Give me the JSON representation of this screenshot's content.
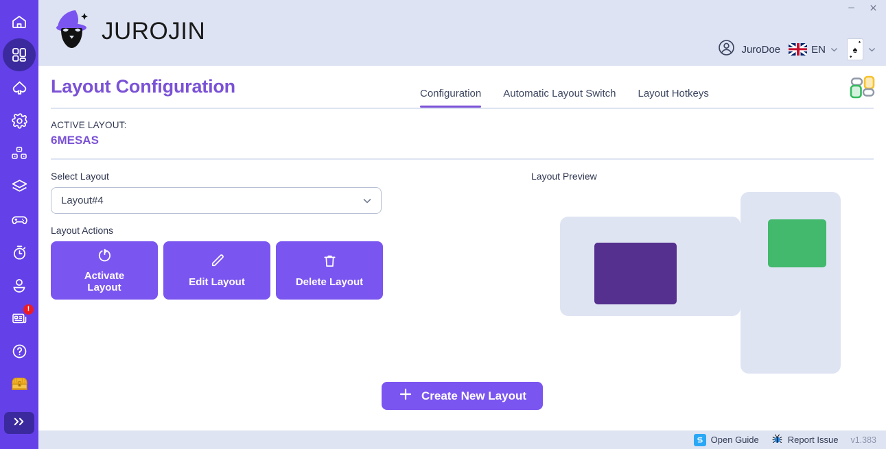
{
  "window": {
    "minimize_label": "—",
    "close_label": "✕"
  },
  "brand": {
    "name": "JUROJIN",
    "logo_icon": "wizard-logo-icon"
  },
  "header": {
    "user_name": "JuroDoe",
    "user_icon": "user-circle-icon",
    "language_code": "EN",
    "language_flag": "uk-flag-icon",
    "card_icon": "ace-of-spades-card-icon",
    "card_suit": "♠",
    "chevron_icon": "chevron-down-icon",
    "layout_grid_icon": "layout-grid-icon"
  },
  "page": {
    "title": "Layout Configuration"
  },
  "tabs": [
    {
      "label": "Configuration",
      "active": true
    },
    {
      "label": "Automatic Layout Switch",
      "active": false
    },
    {
      "label": "Layout Hotkeys",
      "active": false
    }
  ],
  "active_layout": {
    "label": "ACTIVE LAYOUT:",
    "value": "6MESAS"
  },
  "select_layout": {
    "label": "Select Layout",
    "value": "Layout#4",
    "chevron_icon": "chevron-down-icon"
  },
  "layout_actions": {
    "label": "Layout Actions",
    "buttons": [
      {
        "label": "Activate\nLayout",
        "icon": "power-refresh-icon"
      },
      {
        "label": "Edit Layout",
        "icon": "pencil-icon"
      },
      {
        "label": "Delete Layout",
        "icon": "trash-icon"
      }
    ]
  },
  "preview": {
    "label": "Layout Preview",
    "monitors": [
      {
        "name": "monitor-landscape",
        "color": "#DFE4F3"
      },
      {
        "name": "monitor-portrait",
        "color": "#DFE4F3"
      }
    ],
    "windows": [
      {
        "name": "window-purple",
        "color": "#55308F"
      },
      {
        "name": "window-green",
        "color": "#42B96C"
      }
    ]
  },
  "create_button": {
    "label": "Create New Layout",
    "icon": "plus-icon"
  },
  "statusbar": {
    "open_guide": "Open Guide",
    "report_issue": "Report Issue",
    "version": "v1.383",
    "guide_icon": "book-guide-icon",
    "bug_icon": "bug-icon"
  },
  "sidebar": {
    "items": [
      {
        "name": "home",
        "icon": "home-icon"
      },
      {
        "name": "dashboard",
        "icon": "dashboard-grid-icon",
        "active": true
      },
      {
        "name": "spade",
        "icon": "spade-icon"
      },
      {
        "name": "settings",
        "icon": "gear-icon"
      },
      {
        "name": "tables",
        "icon": "tables-icon"
      },
      {
        "name": "layers",
        "icon": "layers-icon"
      },
      {
        "name": "gamepad",
        "icon": "gamepad-icon"
      },
      {
        "name": "timer",
        "icon": "stopwatch-icon"
      },
      {
        "name": "profile",
        "icon": "person-icon"
      },
      {
        "name": "news",
        "icon": "news-icon",
        "badge": "!"
      },
      {
        "name": "help",
        "icon": "question-circle-icon"
      },
      {
        "name": "treasure",
        "icon": "treasure-chest-icon"
      }
    ],
    "expand_label": "»",
    "expand_icon": "chevron-double-right-icon"
  },
  "colors": {
    "sidebar": "#6440E8",
    "accent_purple": "#7B55F0",
    "title_purple": "#7B52D6",
    "band": "#DDE3F2",
    "green": "#42B96C",
    "dark_purple": "#55308F"
  }
}
